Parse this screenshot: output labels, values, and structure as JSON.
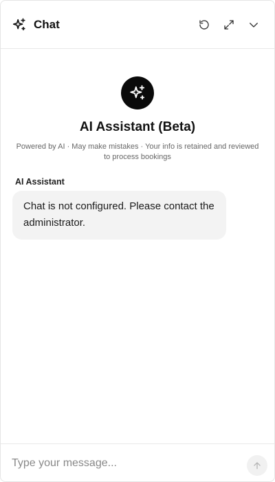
{
  "header": {
    "title": "Chat",
    "icons": [
      "sparkles-icon",
      "refresh-icon",
      "expand-icon",
      "chevron-down-icon"
    ]
  },
  "intro": {
    "assistant_name": "AI Assistant (Beta)",
    "disclaimer": "Powered by AI · May make mistakes · Your info is retained and reviewed to process bookings"
  },
  "messages": [
    {
      "sender": "AI Assistant",
      "text": "Chat is not configured. Please contact the administrator."
    }
  ],
  "composer": {
    "value": "",
    "placeholder": "Type your message..."
  },
  "colors": {
    "avatar_bg": "#0a0a0a",
    "bubble_bg": "#f3f3f3",
    "border": "#e8e8e8"
  }
}
